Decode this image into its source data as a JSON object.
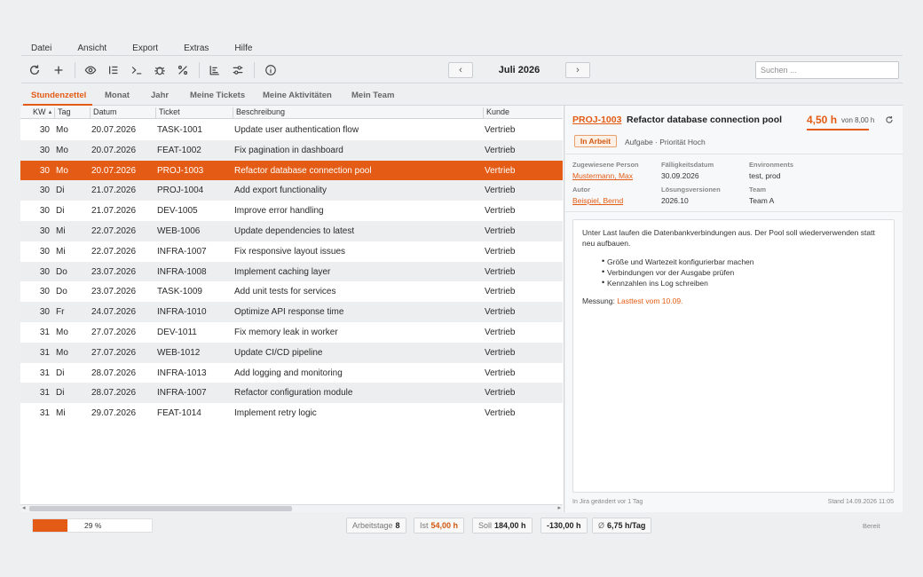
{
  "menu": [
    "Datei",
    "Ansicht",
    "Export",
    "Extras",
    "Hilfe"
  ],
  "toolbar": {
    "icons": [
      "refresh-icon",
      "plus-icon",
      "eye-icon",
      "list-icon",
      "terminal-icon",
      "bug-icon",
      "percent-icon",
      "gantt-icon",
      "sliders-icon",
      "info-icon"
    ],
    "prev": "‹",
    "next": "›",
    "month": "Juli 2026",
    "search_placeholder": "Suchen ..."
  },
  "tabs": [
    "Stundenzettel",
    "Monat",
    "Jahr",
    "Meine Tickets",
    "Meine Aktivitäten",
    "Mein Team"
  ],
  "table": {
    "headers": [
      "KW",
      "Tag",
      "Datum",
      "Ticket",
      "Beschreibung",
      "Kunde"
    ],
    "rows": [
      [
        "30",
        "Mo",
        "20.07.2026",
        "TASK-1001",
        "Update user authentication flow",
        "Vertrieb"
      ],
      [
        "30",
        "Mo",
        "20.07.2026",
        "FEAT-1002",
        "Fix pagination in dashboard",
        "Vertrieb"
      ],
      [
        "30",
        "Mo",
        "20.07.2026",
        "PROJ-1003",
        "Refactor database connection pool",
        "Vertrieb"
      ],
      [
        "30",
        "Di",
        "21.07.2026",
        "PROJ-1004",
        "Add export functionality",
        "Vertrieb"
      ],
      [
        "30",
        "Di",
        "21.07.2026",
        "DEV-1005",
        "Improve error handling",
        "Vertrieb"
      ],
      [
        "30",
        "Mi",
        "22.07.2026",
        "WEB-1006",
        "Update dependencies to latest",
        "Vertrieb"
      ],
      [
        "30",
        "Mi",
        "22.07.2026",
        "INFRA-1007",
        "Fix responsive layout issues",
        "Vertrieb"
      ],
      [
        "30",
        "Do",
        "23.07.2026",
        "INFRA-1008",
        "Implement caching layer",
        "Vertrieb"
      ],
      [
        "30",
        "Do",
        "23.07.2026",
        "TASK-1009",
        "Add unit tests for services",
        "Vertrieb"
      ],
      [
        "30",
        "Fr",
        "24.07.2026",
        "INFRA-1010",
        "Optimize API response time",
        "Vertrieb"
      ],
      [
        "31",
        "Mo",
        "27.07.2026",
        "DEV-1011",
        "Fix memory leak in worker",
        "Vertrieb"
      ],
      [
        "31",
        "Mo",
        "27.07.2026",
        "WEB-1012",
        "Update CI/CD pipeline",
        "Vertrieb"
      ],
      [
        "31",
        "Di",
        "28.07.2026",
        "INFRA-1013",
        "Add logging and monitoring",
        "Vertrieb"
      ],
      [
        "31",
        "Di",
        "28.07.2026",
        "INFRA-1007",
        "Refactor configuration module",
        "Vertrieb"
      ],
      [
        "31",
        "Mi",
        "29.07.2026",
        "FEAT-1014",
        "Implement retry logic",
        "Vertrieb"
      ]
    ],
    "selected_row": 2
  },
  "detail": {
    "key": "PROJ-1003",
    "title": "Refactor database connection pool",
    "hours": "4,50 h",
    "hours_of": "von 8,00 h",
    "status": "In Arbeit",
    "type": "Aufgabe · Priorität Hoch",
    "fields": {
      "assignee_label": "Zugewiesene Person",
      "assignee": "Mustermann, Max",
      "due_label": "Fälligkeitsdatum",
      "due": "30.09.2026",
      "env_label": "Environments",
      "env": "test, prod",
      "author_label": "Autor",
      "author": "Beispiel, Bernd",
      "fix_label": "Lösungsversionen",
      "fix": "2026.10",
      "team_label": "Team",
      "team": "Team A"
    },
    "description": {
      "paragraph": "Unter Last laufen die Datenbankverbindungen aus. Der Pool soll wiederverwenden statt neu aufbauen.",
      "bullets": [
        "Größe und Wartezeit konfigurierbar machen",
        "Verbindungen vor der Ausgabe prüfen",
        "Kennzahlen ins Log schreiben"
      ],
      "measure_label": "Messung:",
      "measure_link": "Lasttest vom 10.09."
    },
    "changed": "In Jira geändert vor 1 Tag",
    "stand": "Stand 14.09.2026 11:05"
  },
  "status": {
    "progress_percent": 29,
    "progress_label": "29 %",
    "workdays_label": "Arbeitstage",
    "workdays": "8",
    "ist_label": "Ist",
    "ist": "54,00 h",
    "soll_label": "Soll",
    "soll": "184,00 h",
    "diff": "-130,00 h",
    "avg_label": "Ø",
    "avg": "6,75 h/Tag",
    "state": "Bereit"
  },
  "colors": {
    "accent": "#e35b14"
  }
}
